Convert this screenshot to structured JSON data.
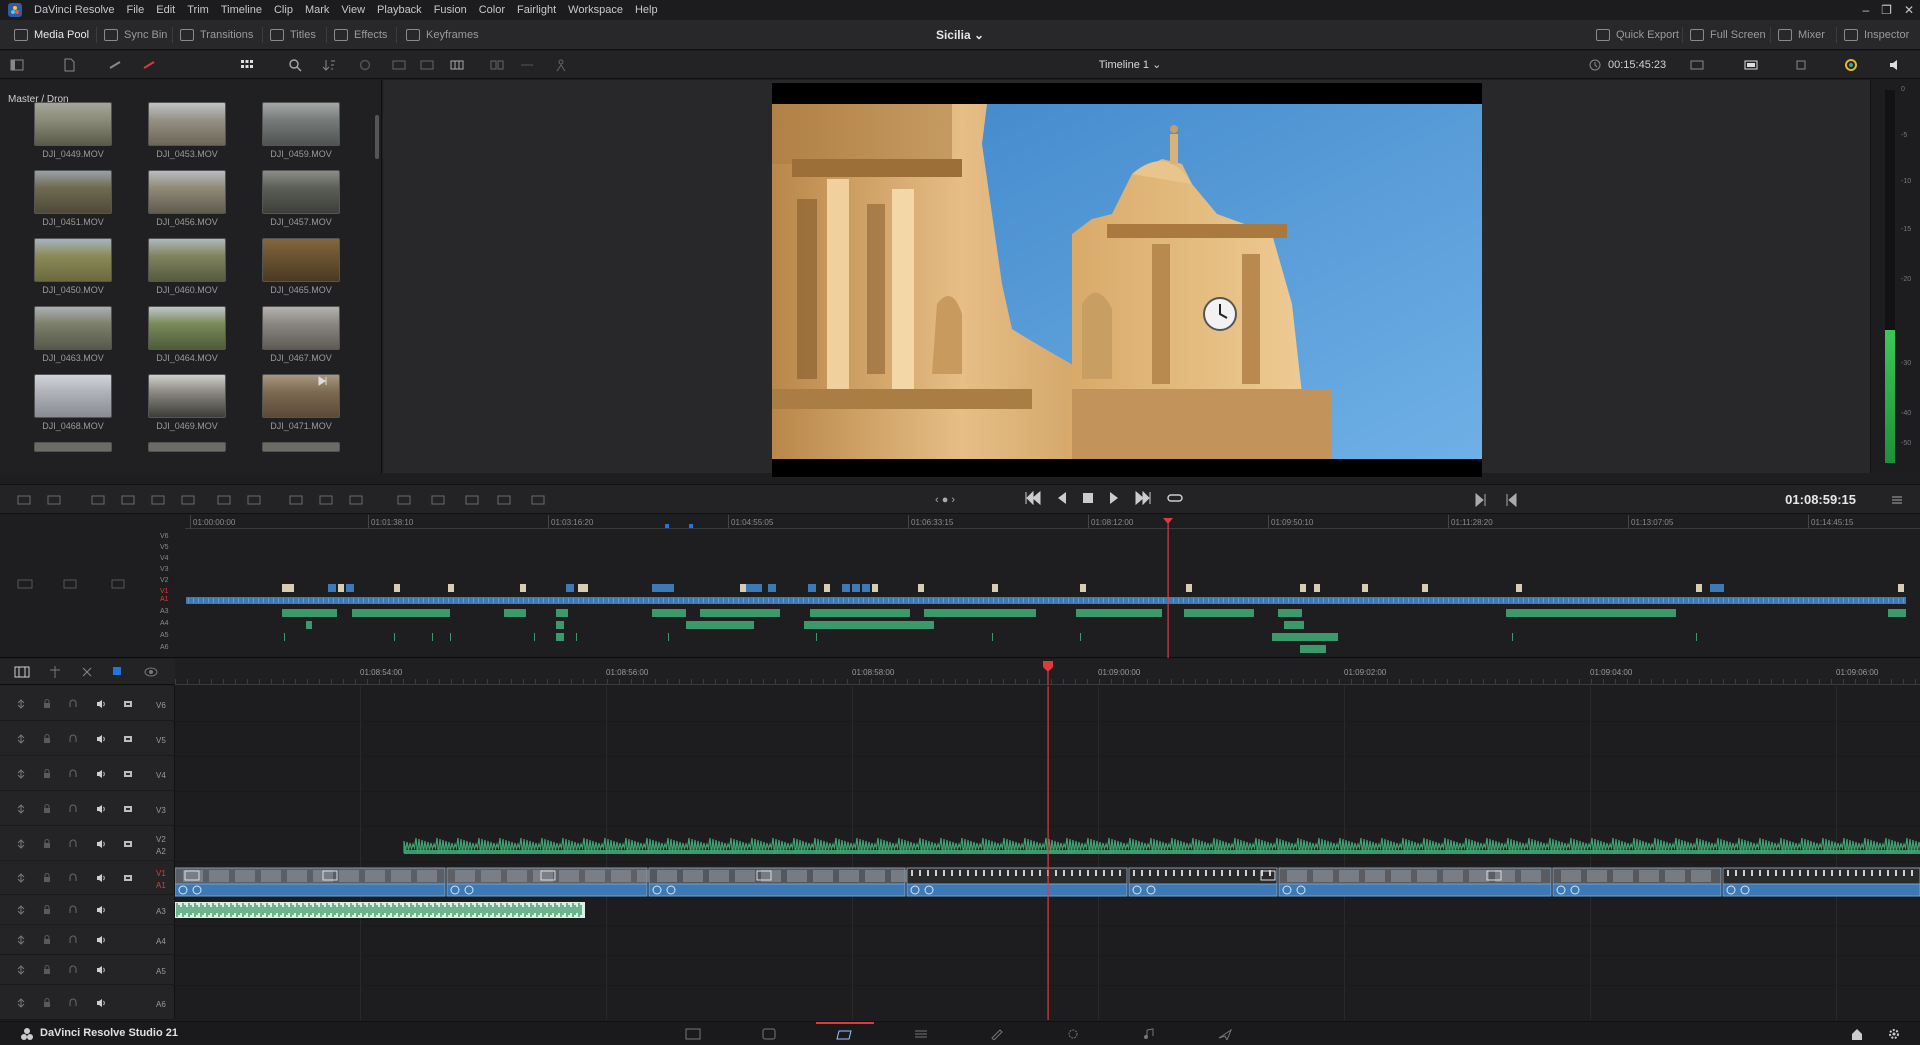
{
  "menubar": {
    "app": "DaVinci Resolve",
    "items": [
      "File",
      "Edit",
      "Trim",
      "Timeline",
      "Clip",
      "Mark",
      "View",
      "Playback",
      "Fusion",
      "Color",
      "Fairlight",
      "Workspace",
      "Help"
    ]
  },
  "toolbar": {
    "left": [
      "Media Pool",
      "Sync Bin",
      "Transitions",
      "Titles",
      "Effects",
      "Keyframes"
    ],
    "project": "Sicilia",
    "right": [
      "Quick Export",
      "Full Screen",
      "Mixer",
      "Inspector"
    ]
  },
  "subbar": {
    "timeline_name": "Timeline 1",
    "timecode": "00:15:45:23"
  },
  "mediapool": {
    "breadcrumb": "Master / Dron",
    "clips": [
      "DJI_0449.MOV",
      "DJI_0453.MOV",
      "DJI_0459.MOV",
      "DJI_0451.MOV",
      "DJI_0456.MOV",
      "DJI_0457.MOV",
      "DJI_0450.MOV",
      "DJI_0460.MOV",
      "DJI_0465.MOV",
      "DJI_0463.MOV",
      "DJI_0464.MOV",
      "DJI_0467.MOV",
      "DJI_0468.MOV",
      "DJI_0469.MOV",
      "DJI_0471.MOV"
    ]
  },
  "meter": {
    "labels": [
      "0",
      "-5",
      "-10",
      "-15",
      "-20",
      "-30",
      "-40",
      "-50"
    ]
  },
  "transport": {
    "timecode": "01:08:59:15"
  },
  "overview": {
    "ruler": [
      "01:00:00:00",
      "01:01:38:10",
      "01:03:16:20",
      "01:04:55:05",
      "01:06:33:15",
      "01:08:12:00",
      "01:09:50:10",
      "01:11:28:20",
      "01:13:07:05",
      "01:14:45:15"
    ],
    "tracks": [
      "V6",
      "V5",
      "V4",
      "V3",
      "V2",
      "V1",
      "A1",
      "A3",
      "A4",
      "A5",
      "A6"
    ]
  },
  "timeline": {
    "ruler": [
      "01:08:54:00",
      "01:08:56:00",
      "01:08:58:00",
      "01:09:00:00",
      "01:09:02:00",
      "01:09:04:00",
      "01:09:06:00"
    ],
    "tracks": [
      {
        "name": "V6"
      },
      {
        "name": "V5"
      },
      {
        "name": "V4"
      },
      {
        "name": "V3"
      },
      {
        "name": "V2",
        "sub": "A2"
      },
      {
        "name": "V1",
        "sub": "A1"
      },
      {
        "name": "A3"
      },
      {
        "name": "A4"
      },
      {
        "name": "A5"
      },
      {
        "name": "A6"
      }
    ]
  },
  "bottombar": {
    "app_name": "DaVinci Resolve Studio 21"
  },
  "colors": {
    "accent": "#e0393d",
    "clip_blue": "#3d79b5",
    "clip_green": "#3c9a6a",
    "playhead": "#e0393d"
  }
}
